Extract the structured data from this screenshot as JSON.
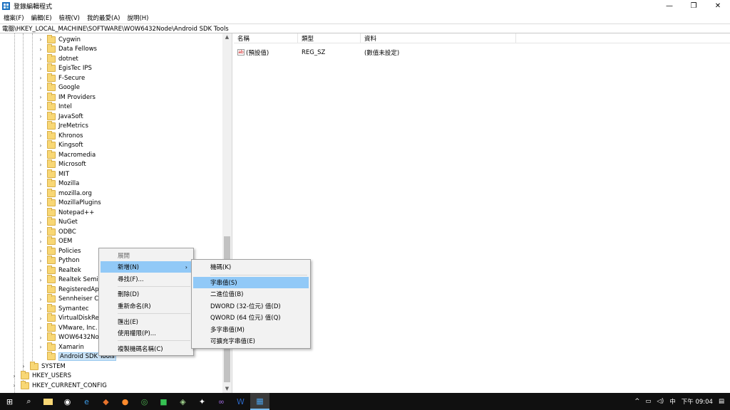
{
  "window": {
    "title": "登錄編輯程式",
    "minimize": "—",
    "restore": "❐",
    "close": "✕"
  },
  "menu": [
    "檔案(F)",
    "編輯(E)",
    "檢視(V)",
    "我的最愛(A)",
    "說明(H)"
  ],
  "address": "電腦\\HKEY_LOCAL_MACHINE\\SOFTWARE\\WOW6432Node\\Android SDK Tools",
  "tree": {
    "software_children": [
      "Cygwin",
      "Data Fellows",
      "dotnet",
      "EgisTec IPS",
      "F-Secure",
      "Google",
      "IM Providers",
      "Intel",
      "JavaSoft",
      "JreMetrics",
      "Khronos",
      "Kingsoft",
      "Macromedia",
      "Microsoft",
      "MIT",
      "Mozilla",
      "mozilla.org",
      "MozillaPlugins",
      "Notepad++",
      "NuGet",
      "ODBC",
      "OEM",
      "Policies",
      "Python",
      "Realtek",
      "Realtek Semic",
      "RegisteredApp",
      "Sennheiser Co",
      "Symantec",
      "VirtualDiskRed",
      "VMware, Inc.",
      "WOW6432No",
      "Xamarin",
      "Android SDK Tools"
    ],
    "no_expander": [
      "JreMetrics",
      "Notepad++",
      "RegisteredApp",
      "Android SDK Tools"
    ],
    "selected": "Android SDK Tools",
    "system": "SYSTEM",
    "hkey_users": "HKEY_USERS",
    "hkey_current_config": "HKEY_CURRENT_CONFIG"
  },
  "list": {
    "headers": {
      "name": "名稱",
      "type": "類型",
      "data": "資料"
    },
    "rows": [
      {
        "icon": "ab",
        "name": "(預設值)",
        "type": "REG_SZ",
        "data": "(數值未設定)"
      }
    ]
  },
  "context_menu": {
    "expand": "展開",
    "new": "新增(N)",
    "find": "尋找(F)...",
    "delete": "刪除(D)",
    "rename": "重新命名(R)",
    "export": "匯出(E)",
    "permissions": "使用權限(P)...",
    "copy_key_name": "複製機碼名稱(C)",
    "submenu_arrow": "›"
  },
  "new_submenu": {
    "key": "機碼(K)",
    "string": "字串值(S)",
    "binary": "二進位值(B)",
    "dword": "DWORD (32-位元) 值(D)",
    "qword": "QWORD (64 位元) 值(Q)",
    "multi_string": "多字串值(M)",
    "expandable_string": "可擴充字串值(E)"
  },
  "taskbar": {
    "tray": {
      "chevron": "^",
      "ime": "中",
      "time": "下午 09:04"
    }
  },
  "colors": {
    "highlight": "#91c9f7",
    "selection": "#cce4f7",
    "folder": "#f8d775",
    "taskbar": "#101010"
  }
}
